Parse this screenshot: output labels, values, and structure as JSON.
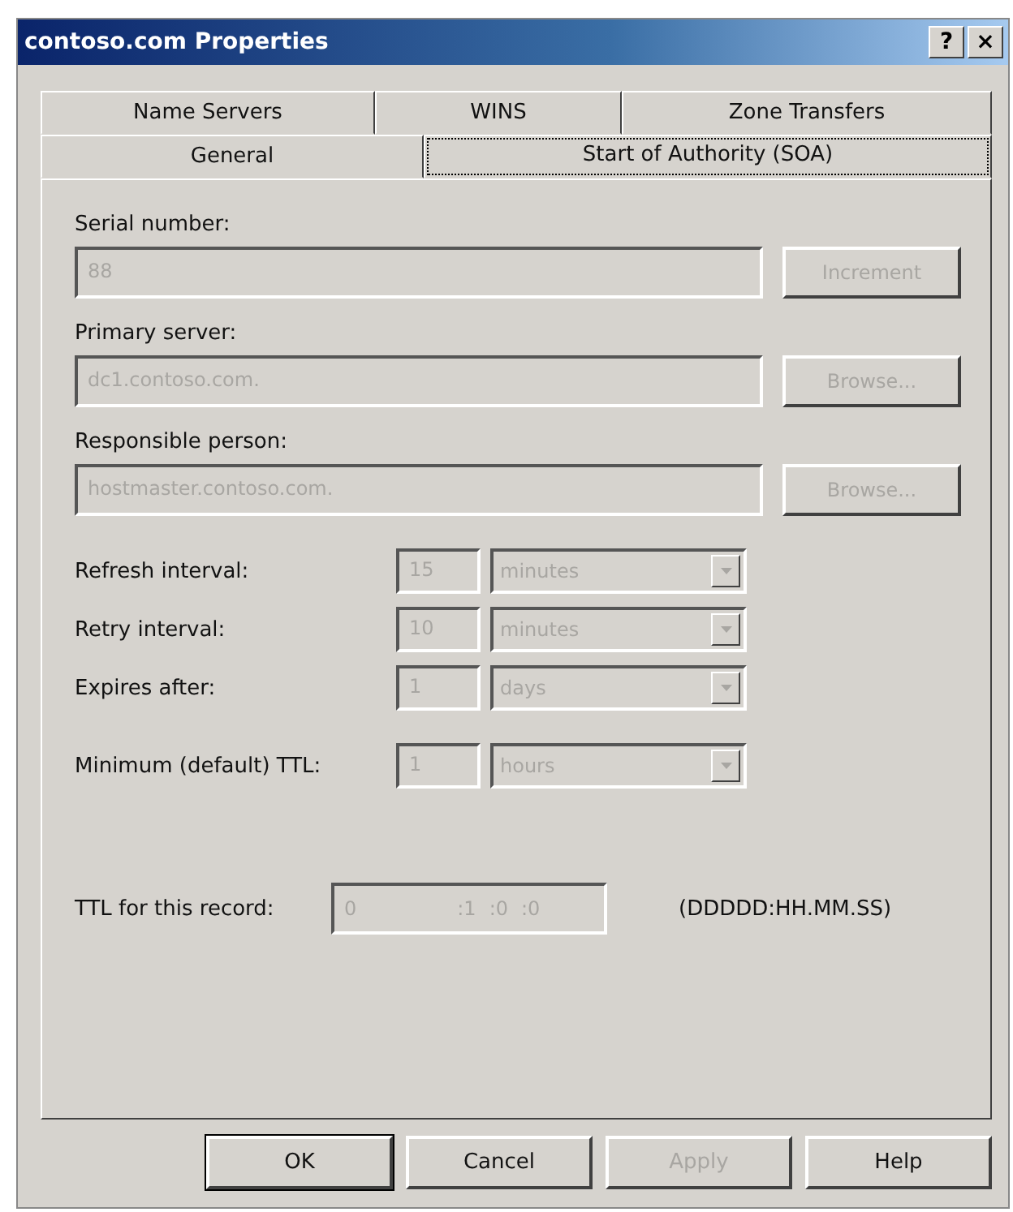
{
  "window": {
    "title": "contoso.com Properties",
    "controls": [
      "?",
      "×"
    ]
  },
  "tab_rows": [
    [
      {
        "label": "Name Servers",
        "selected": false
      },
      {
        "label": "WINS",
        "selected": false
      },
      {
        "label": "Zone Transfers",
        "selected": false
      }
    ],
    [
      {
        "label": "General",
        "selected": false
      },
      {
        "label": "Start of Authority (SOA)",
        "selected": true
      }
    ]
  ],
  "fields": [
    {
      "label": "Serial number:",
      "value": "88",
      "disabled": true,
      "button": {
        "label": "Increment",
        "disabled": true
      }
    },
    {
      "label": "Primary server:",
      "value": "dc1.contoso.com.",
      "disabled": true,
      "button": {
        "label": "Browse...",
        "disabled": true
      }
    },
    {
      "label": "Responsible person:",
      "value": "hostmaster.contoso.com.",
      "disabled": true,
      "button": {
        "label": "Browse...",
        "disabled": true
      }
    }
  ],
  "intervals": [
    {
      "label": "Refresh interval:",
      "value": "15",
      "unit": "minutes",
      "disabled": true
    },
    {
      "label": "Retry interval:",
      "value": "10",
      "unit": "minutes",
      "disabled": true
    },
    {
      "label": "Expires after:",
      "value": "1",
      "unit": "days",
      "disabled": true
    },
    {
      "label": "Minimum (default) TTL:",
      "value": "1",
      "unit": "hours",
      "disabled": true
    }
  ],
  "ttl": {
    "label": "TTL for this record:",
    "parts": [
      "0",
      ":1",
      ":0",
      ":0"
    ],
    "disabled": true,
    "format": "(DDDDD:HH.MM.SS)"
  },
  "buttons": [
    {
      "label": "OK",
      "disabled": false,
      "default": true
    },
    {
      "label": "Cancel",
      "disabled": false,
      "default": false
    },
    {
      "label": "Apply",
      "disabled": true,
      "default": false
    },
    {
      "label": "Help",
      "disabled": false,
      "default": false
    }
  ]
}
